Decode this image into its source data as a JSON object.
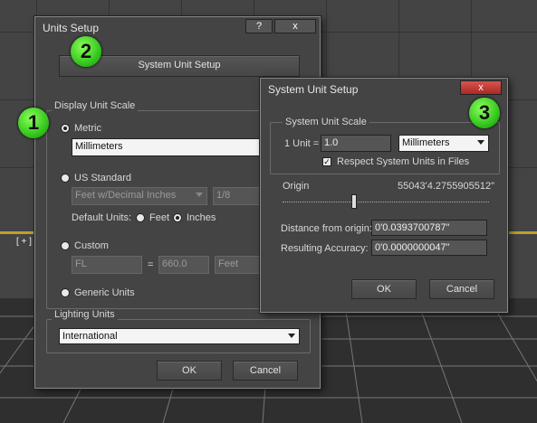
{
  "viewport": {
    "label": "[ + ]"
  },
  "units_setup": {
    "title": "Units Setup",
    "help_btn": "?",
    "close_btn": "x",
    "system_unit_setup_btn": "System Unit Setup",
    "display_unit_scale_label": "Display Unit Scale",
    "metric_label": "Metric",
    "metric_value": "Millimeters",
    "us_standard_label": "US Standard",
    "us_standard_value": "Feet w/Decimal Inches",
    "fraction_value": "1/8",
    "default_units_label": "Default Units:",
    "feet_label": "Feet",
    "inches_label": "Inches",
    "custom_label": "Custom",
    "custom_name": "FL",
    "equals": "=",
    "custom_value": "660.0",
    "custom_unit": "Feet",
    "generic_units_label": "Generic Units",
    "lighting_units_label": "Lighting Units",
    "lighting_value": "International",
    "ok": "OK",
    "cancel": "Cancel"
  },
  "system_unit_setup": {
    "title": "System Unit Setup",
    "close_btn": "x",
    "scale_label": "System Unit Scale",
    "one_unit_label": "1 Unit =",
    "unit_value": "1.0",
    "unit_type": "Millimeters",
    "respect_label": "Respect System Units in Files",
    "respect_checked": true,
    "origin_label": "Origin",
    "origin_value": "55043'4.2755905512\"",
    "distance_label": "Distance from origin:",
    "distance_value": "0'0.0393700787\"",
    "accuracy_label": "Resulting Accuracy:",
    "accuracy_value": "0'0.0000000047\"",
    "ok": "OK",
    "cancel": "Cancel"
  },
  "badges": {
    "one": "1",
    "two": "2",
    "three": "3"
  },
  "colors": {
    "accent_badge": "#2fc21a",
    "viewport_border": "#bda12e",
    "close_red": "#c0392b"
  }
}
